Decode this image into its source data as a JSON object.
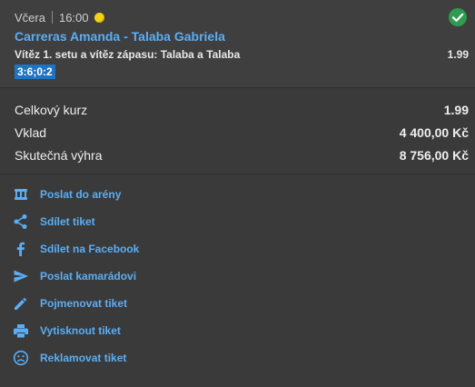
{
  "bet": {
    "day": "Včera",
    "time": "16:00",
    "match": "Carreras Amanda - Talaba Gabriela",
    "description": "Vítěz 1. setu a vítěz zápasu: Talaba a Talaba",
    "odds": "1.99",
    "result": "3:6;0:2",
    "status_color": "#2e9b4e"
  },
  "summary": {
    "total_odds_label": "Celkový kurz",
    "total_odds_value": "1.99",
    "stake_label": "Vklad",
    "stake_value": "4 400,00 Kč",
    "win_label": "Skutečná výhra",
    "win_value": "8 756,00 Kč"
  },
  "actions": [
    {
      "label": "Poslat do arény",
      "icon": "arena-icon"
    },
    {
      "label": "Sdílet tiket",
      "icon": "share-icon"
    },
    {
      "label": "Sdílet na Facebook",
      "icon": "facebook-icon"
    },
    {
      "label": "Poslat kamarádovi",
      "icon": "send-icon"
    },
    {
      "label": "Pojmenovat tiket",
      "icon": "pencil-icon"
    },
    {
      "label": "Vytisknout tiket",
      "icon": "printer-icon"
    },
    {
      "label": "Reklamovat tiket",
      "icon": "sad-face-icon"
    }
  ],
  "colors": {
    "accent": "#5aaef5",
    "badge": "#1f73c4",
    "background": "#3a3a3a"
  }
}
